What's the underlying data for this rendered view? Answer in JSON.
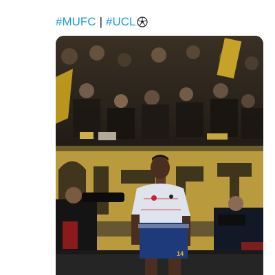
{
  "tweet": {
    "hashtags": [
      "#MUFC",
      "#UCL"
    ],
    "separator": "|",
    "emoji_icon": "soccer-ball-icon"
  },
  "media": {
    "photo_text": {
      "shirt_number": "14"
    }
  },
  "colors": {
    "hashtag": "#1d9bd6",
    "text": "#1f1f1f",
    "background": "#ffffff"
  }
}
